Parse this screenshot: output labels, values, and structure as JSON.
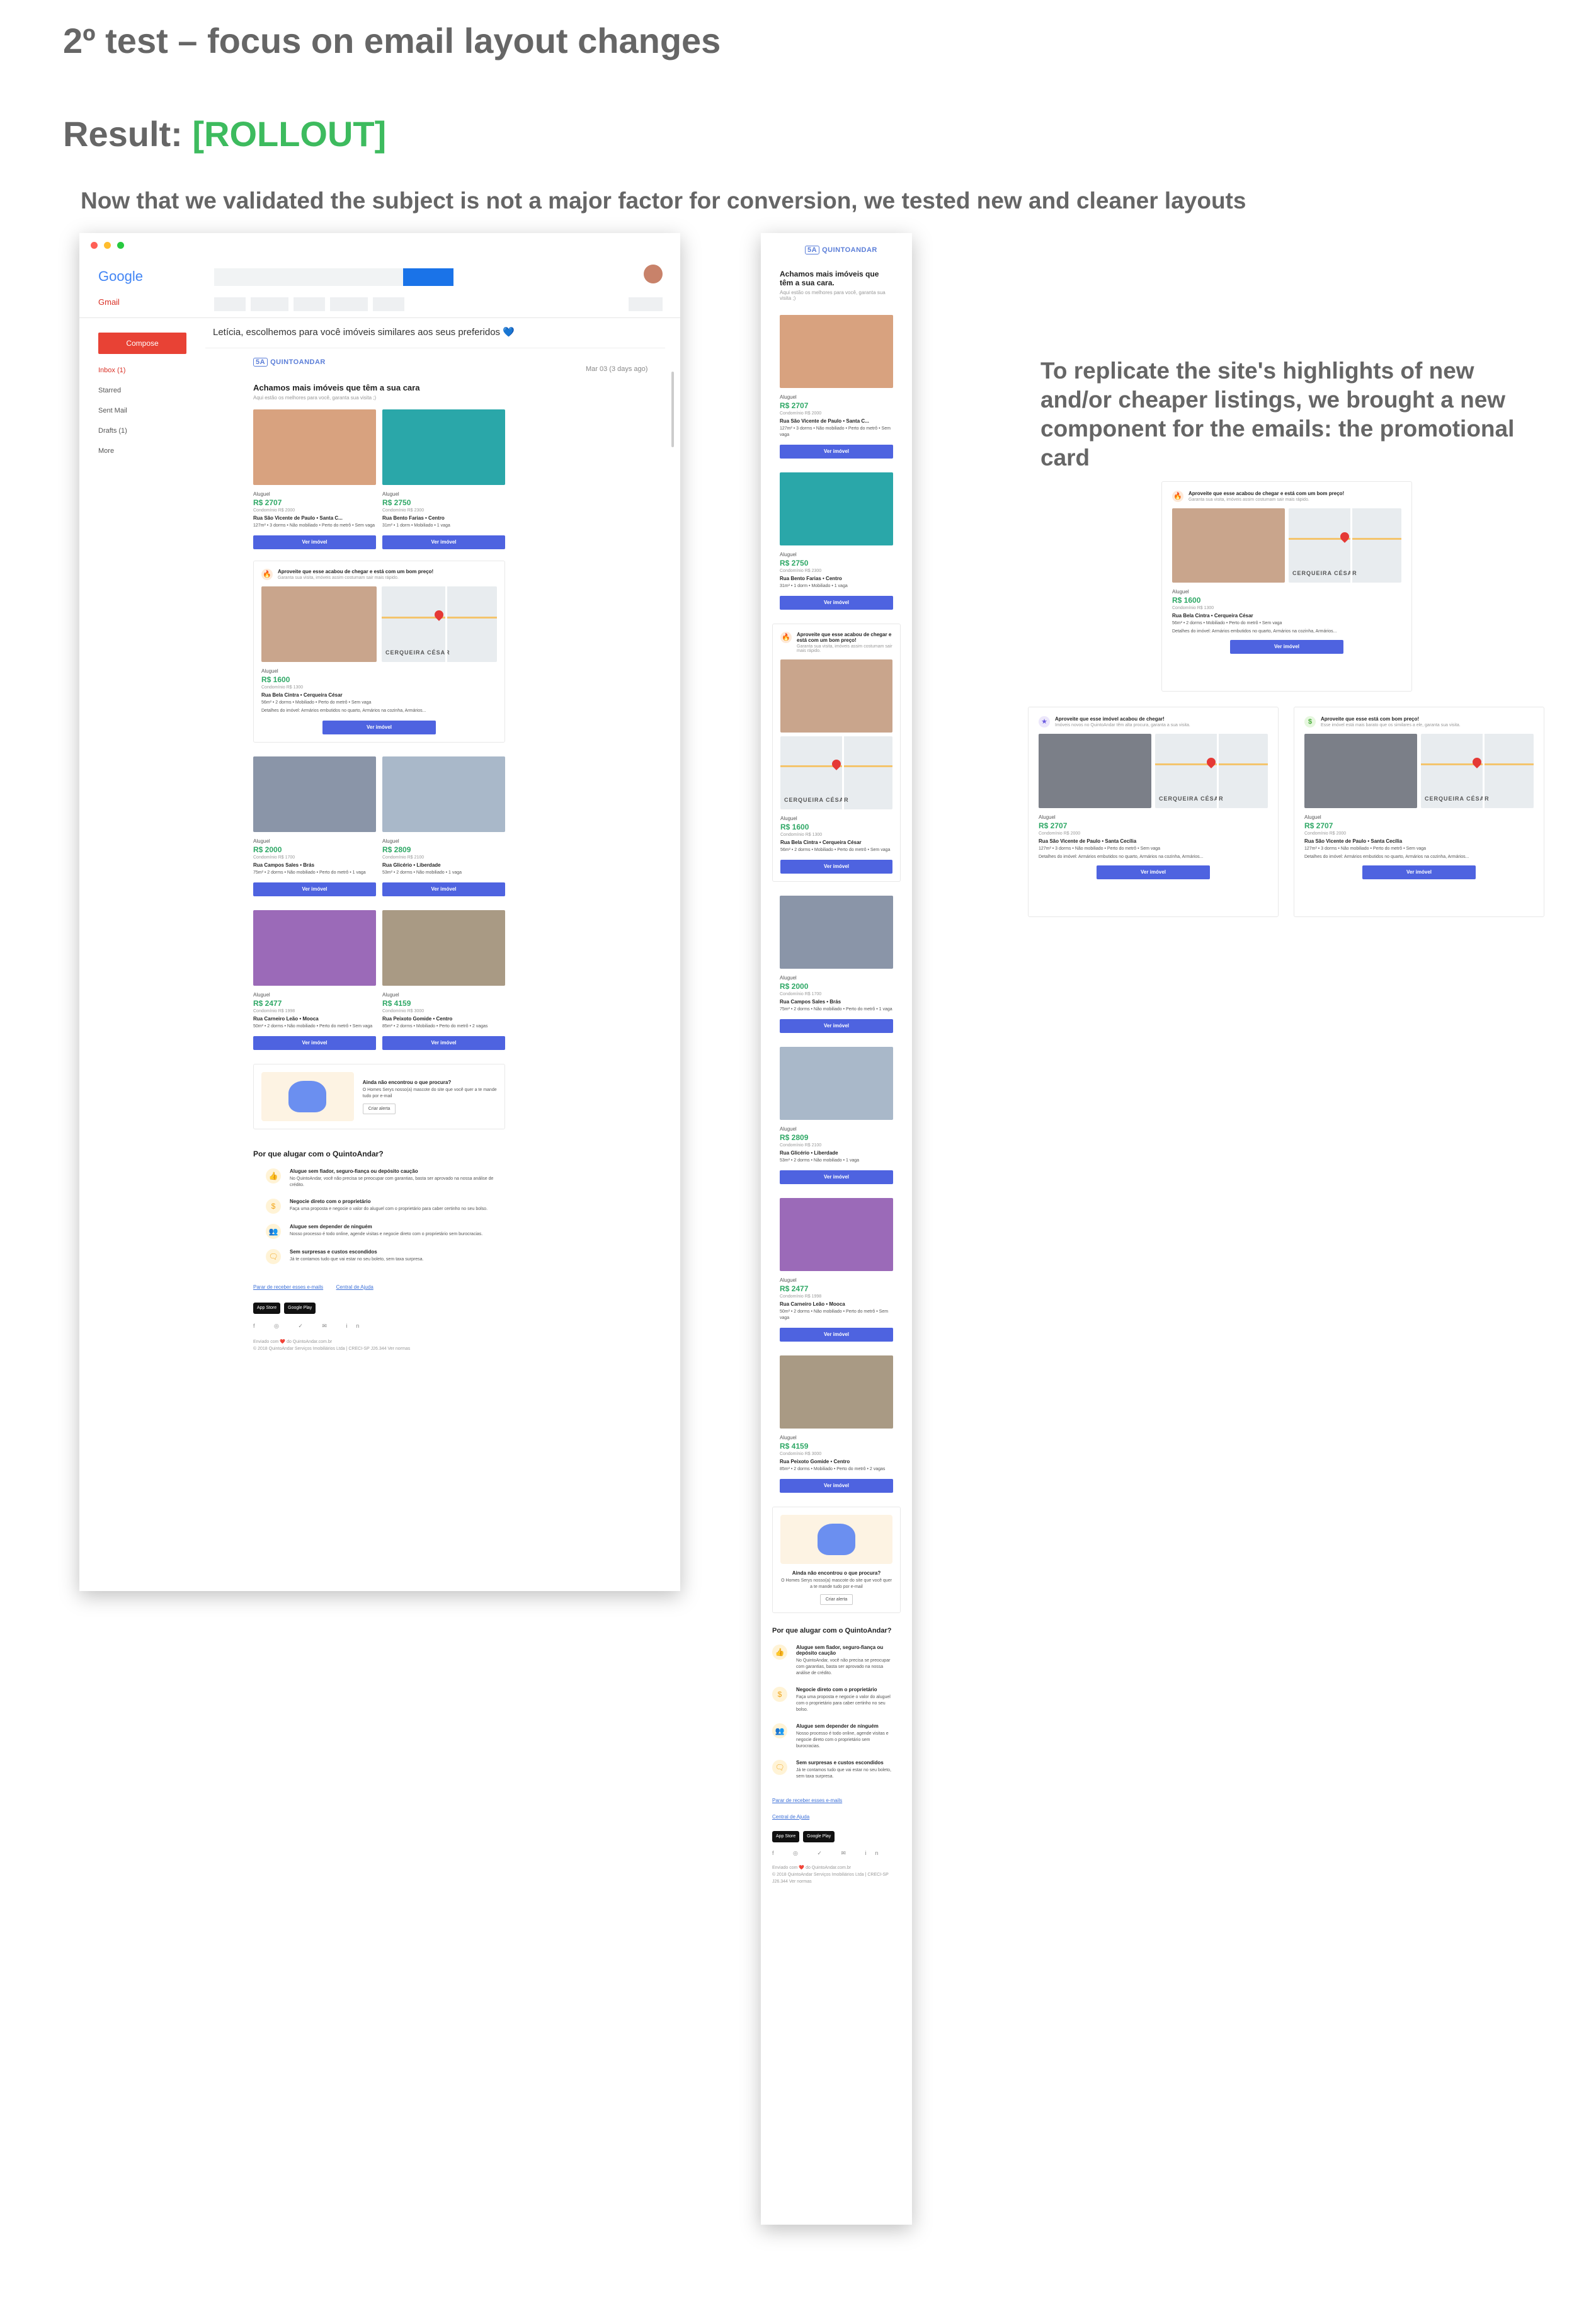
{
  "page": {
    "title": "2º test – focus on email layout changes",
    "result_label": "Result:",
    "result_value": "[ROLLOUT]",
    "intro": "Now that we validated the subject is not a major factor for conversion, we tested new and cleaner layouts",
    "note": "To replicate the site's highlights of new and/or cheaper listings, we brought a new component for the emails: the promotional card"
  },
  "colors": {
    "accent": "#4e63e0",
    "price": "#2fa866",
    "rollout": "#3dbb5e",
    "gmail_red": "#e84235"
  },
  "gmail": {
    "brand": "Google",
    "product": "Gmail",
    "compose": "Compose",
    "nav": [
      "Inbox (1)",
      "Starred",
      "Sent Mail",
      "Drafts (1)",
      "More"
    ],
    "subject": "Letícia, escolhemos para você imóveis similares aos seus preferidos 💙",
    "date": "Mar 03 (3 days ago)"
  },
  "email": {
    "logo_mark": "5A",
    "logo": "QUINTOANDAR",
    "headline": "Achamos mais imóveis que têm a sua cara",
    "headline_mobile": "Achamos mais imóveis que têm a sua cara.",
    "subline": "Aqui estão os melhores para você, garanta sua visita ;)",
    "listing_label": "Aluguel",
    "button": "Ver imóvel",
    "listings": [
      {
        "price": "R$ 2707",
        "cond": "Condomínio R$ 2000",
        "addr": "Rua São Vicente de Paulo • Santa C...",
        "det": "127m² • 3 dorms • Não mobiliado • Perto do metrô • Sem vaga",
        "color": "#d8a27f"
      },
      {
        "price": "R$ 2750",
        "cond": "Condomínio R$ 2300",
        "addr": "Rua Bento Farias • Centro",
        "det": "31m² • 1 dorm • Mobiliado • 1 vaga",
        "color": "#2aa7a9"
      },
      {
        "price": "R$ 2000",
        "cond": "Condomínio R$ 1700",
        "addr": "Rua Campos Sales • Brás",
        "det": "75m² • 2 dorms • Não mobiliado • Perto do metrô • 1 vaga",
        "color": "#8a95a8"
      },
      {
        "price": "R$ 2809",
        "cond": "Condomínio R$ 2100",
        "addr": "Rua Glicério • Liberdade",
        "det": "53m² • 2 dorms • Não mobiliado • 1 vaga",
        "color": "#a9b8c9"
      },
      {
        "price": "R$ 2477",
        "cond": "Condomínio R$ 1998",
        "addr": "Rua Carneiro Leão • Mooca",
        "det": "50m² • 2 dorms • Não mobiliado • Perto do metrô • Sem vaga",
        "color": "#9b6ab8"
      },
      {
        "price": "R$ 4159",
        "cond": "Condomínio R$ 3000",
        "addr": "Rua Peixoto Gomide • Centro",
        "det": "85m² • 2 dorms • Mobiliado • Perto do metrô • 2 vagas",
        "color": "#a99a84"
      }
    ],
    "promo": {
      "title": "Aproveite que esse acabou de chegar e está com um bom preço!",
      "sub": "Garanta sua visita, imóveis assim costumam sair mais rápido.",
      "price": "R$ 1600",
      "cond": "Condomínio R$ 1300",
      "addr": "Rua Bela Cintra • Cerqueira César",
      "det": "56m² • 2 dorms • Mobiliado • Perto do metrô • Sem vaga",
      "extra": "Detalhes do imóvel: Armários embutidos no quarto, Armários na cozinha, Armários...",
      "map_label": "CERQUEIRA CÉSAR"
    },
    "promo_new": {
      "title": "Aproveite que esse imóvel acabou de chegar!",
      "sub": "Imóveis novos no QuintoAndar têm alta procura, garanta a sua visita."
    },
    "promo_cheap": {
      "title": "Aproveite que esse está com bom preço!",
      "sub": "Esse imóvel está mais barato que os similares a ele, garanta sua visita."
    },
    "promo_listing": {
      "price": "R$ 2707",
      "cond": "Condomínio R$ 2000",
      "addr": "Rua São Vicente de Paulo • Santa Cecília",
      "det": "127m² • 3 dorms • Não mobiliado • Perto do metrô • Sem vaga",
      "extra": "Detalhes do imóvel: Armários embutidos no quarto, Armários na cozinha, Armários..."
    },
    "alert": {
      "title": "Ainda não encontrou o que procura?",
      "text": "O Homes Serys nosso(a) mascote do site que você quer a te mande tudo por e-mail",
      "button": "Criar alerta"
    },
    "why": {
      "title": "Por que alugar com o QuintoAndar?",
      "items": [
        {
          "icon": "👍",
          "title": "Alugue sem fiador, seguro-fiança ou depósito caução",
          "text": "No QuintoAndar, você não precisa se preocupar com garantias, basta ser aprovado na nossa análise de crédito."
        },
        {
          "icon": "$",
          "title": "Negocie direto com o proprietário",
          "text": "Faça uma proposta e negocie o valor do aluguel com o proprietário para caber certinho no seu bolso."
        },
        {
          "icon": "👥",
          "title": "Alugue sem depender de ninguém",
          "text": "Nosso processo é todo online, agende visitas e negocie direto com o proprietário sem burocracias."
        },
        {
          "icon": "🗨",
          "title": "Sem surpresas e custos escondidos",
          "text": "Já te contamos tudo que vai estar no seu boleto, sem taxa surpresa."
        }
      ]
    },
    "links": [
      "Parar de receber esses e-mails",
      "Central de Ajuda"
    ],
    "stores": [
      "App Store",
      "Google Play"
    ],
    "social": "f ◎ ✓ ✉ in",
    "footer1": "Enviado com ❤️ do QuintoAndar.com.br",
    "footer2": "© 2018 QuintoAndar Serviços Imobiliários Ltda | CRECI-SP J26.344 Ver normas"
  }
}
